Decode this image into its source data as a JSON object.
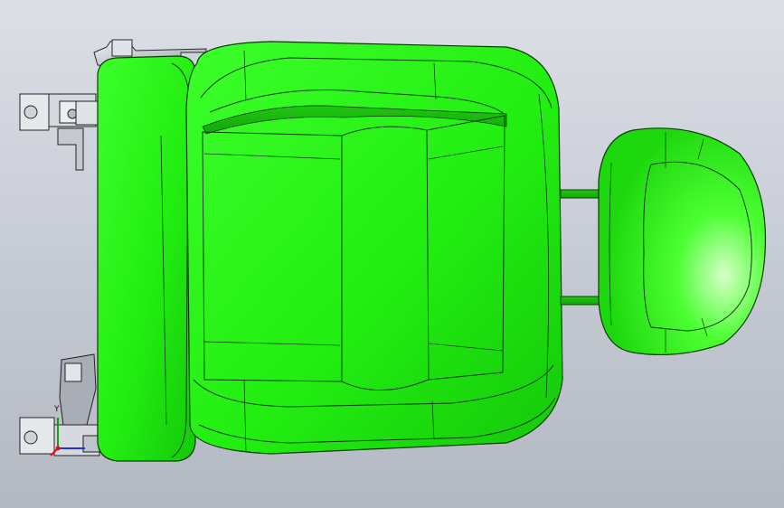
{
  "viewport": {
    "background_top": "#dcdfe6",
    "background_bottom": "#b4b8c2"
  },
  "model": {
    "part": "seat-assembly",
    "body_color": "#22ee11",
    "edge_color": "#0b3b05",
    "hardware_color": "#c8cbd2"
  },
  "triad": {
    "y_label": "Y",
    "x_color": "#d11",
    "y_color": "#1a9a1a",
    "z_color": "#2233dd"
  }
}
